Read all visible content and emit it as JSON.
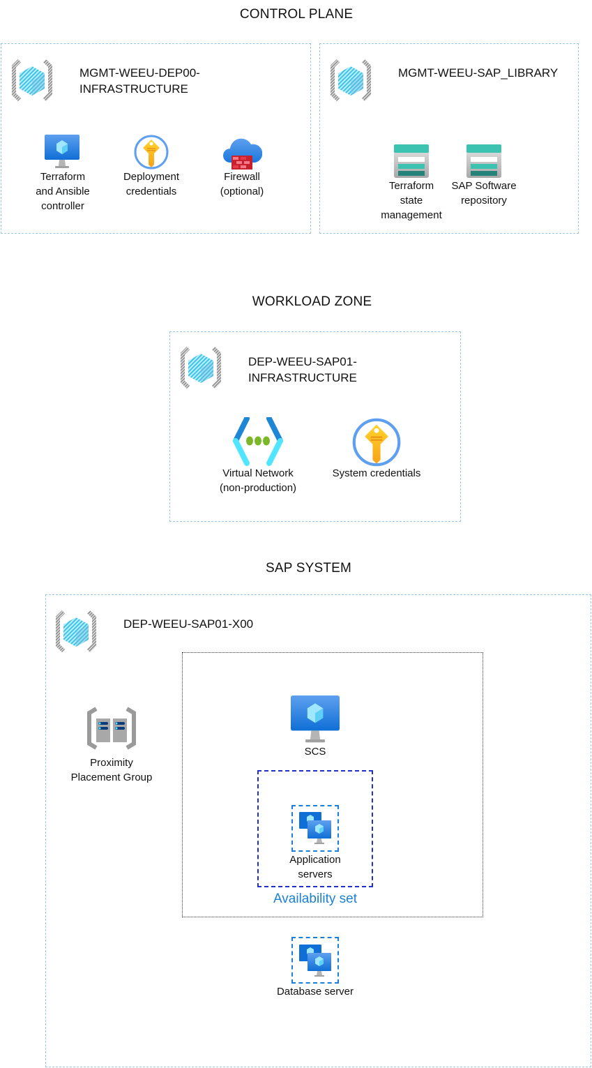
{
  "control_plane": {
    "title": "CONTROL PLANE",
    "deployer": {
      "name_line1": "MGMT-WEEU-DEP00-",
      "name_line2": "INFRASTRUCTURE",
      "icon": "resource-group-icon",
      "items": [
        {
          "icon": "virtual-machine-icon",
          "label_lines": [
            "Terraform",
            "and Ansible",
            "controller"
          ]
        },
        {
          "icon": "key-vault-icon",
          "label_lines": [
            "Deployment",
            "credentials"
          ]
        },
        {
          "icon": "firewall-icon",
          "label_lines": [
            "Firewall",
            "(optional)"
          ]
        }
      ]
    },
    "library": {
      "name": "MGMT-WEEU-SAP_LIBRARY",
      "icon": "resource-group-icon",
      "items": [
        {
          "icon": "storage-account-icon",
          "label_lines": [
            "Terraform",
            "state",
            "management"
          ]
        },
        {
          "icon": "storage-account-icon",
          "label_lines": [
            "SAP Software",
            "repository"
          ]
        }
      ]
    }
  },
  "workload_zone": {
    "title": "WORKLOAD ZONE",
    "name_line1": "DEP-WEEU-SAP01-",
    "name_line2": "INFRASTRUCTURE",
    "icon": "resource-group-icon",
    "items": [
      {
        "icon": "virtual-network-icon",
        "label_lines": [
          "Virtual Network",
          "(non-production)"
        ]
      },
      {
        "icon": "key-vault-icon",
        "label_lines": [
          "System credentials"
        ]
      }
    ]
  },
  "sap_system": {
    "title": "SAP SYSTEM",
    "name": "DEP-WEEU-SAP01-X00",
    "icon": "resource-group-icon",
    "ppg": {
      "icon": "proximity-placement-group-icon",
      "label_lines": [
        "Proximity",
        "Placement Group"
      ]
    },
    "scs": {
      "icon": "virtual-machine-icon",
      "label": "SCS"
    },
    "availability_set": {
      "label": "Availability set",
      "app_servers": {
        "icon": "vm-scale-set-icon",
        "label_lines": [
          "Application",
          "servers"
        ]
      }
    },
    "database": {
      "icon": "vm-scale-set-icon",
      "label": "Database server"
    }
  },
  "colors": {
    "rg_border": "#9cc6ea",
    "availability_set_border": "#1f2fd6",
    "availability_set_label": "#1a7fd6",
    "vm_blue": "#2f86e0",
    "key_yellow": "#ffc20e",
    "storage_teal": "#3cc2b0"
  }
}
